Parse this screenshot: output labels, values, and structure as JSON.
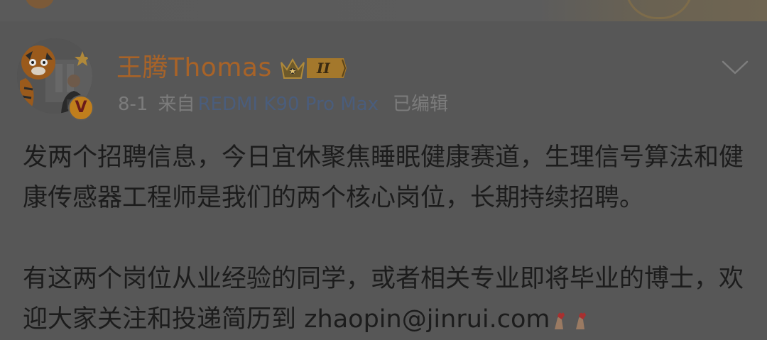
{
  "post": {
    "author": {
      "name": "王腾Thomas",
      "vip_level": "II",
      "verified_icon": "verified-v-icon",
      "crown_icon": "crown-icon"
    },
    "meta": {
      "time": "8-1",
      "source_prefix": "来自",
      "device": "REDMI K90 Pro Max",
      "edited": "已编辑"
    },
    "content": {
      "paragraph1": "发两个招聘信息，今日宜休聚焦睡眠健康赛道，生理信号算法和健康传感器工程师是我们的两个核心岗位，长期持续招聘。",
      "paragraph2_text": "有这两个岗位从业经验的同学，或者相关专业即将毕业的博士，欢迎大家关注和投递简历到",
      "email": "zhaopin@jinrui.com"
    }
  },
  "colors": {
    "background": "#575757",
    "username": "#a86328",
    "device_link": "#4a5d7c",
    "meta_text": "#7c7c7c",
    "body_text": "#1c1c1c"
  }
}
